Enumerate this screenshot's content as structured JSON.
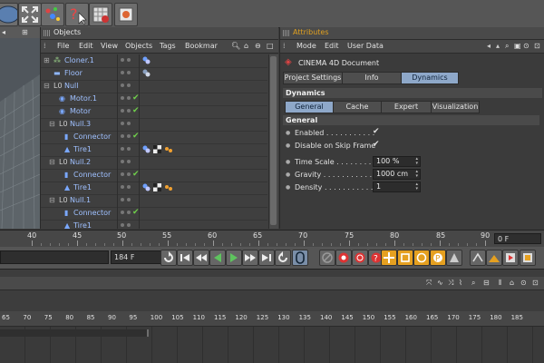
{
  "objects": {
    "title": "Objects",
    "menu": [
      "File",
      "Edit",
      "View",
      "Objects",
      "Tags",
      "Bookmarks"
    ],
    "rows": [
      {
        "label": "Cloner.1"
      },
      {
        "label": "Floor"
      },
      {
        "label": "Null"
      },
      {
        "label": "Motor.1"
      },
      {
        "label": "Motor"
      },
      {
        "label": "Null.3"
      },
      {
        "label": "Connector"
      },
      {
        "label": "Tire1"
      },
      {
        "label": "Null.2"
      },
      {
        "label": "Connector"
      },
      {
        "label": "Tire1"
      },
      {
        "label": "Null.1"
      },
      {
        "label": "Connector"
      },
      {
        "label": "Tire1"
      }
    ]
  },
  "attributes": {
    "title": "Attributes",
    "menu": [
      "Mode",
      "Edit",
      "User Data"
    ],
    "document": "CINEMA 4D Document",
    "tabs": [
      "Project Settings",
      "Info",
      "Dynamics"
    ],
    "active_tab": "Dynamics",
    "section_title": "Dynamics",
    "subtabs": [
      "General",
      "Cache",
      "Expert",
      "Visualization"
    ],
    "active_subtab": "General",
    "group_title": "General",
    "enabled_label": "Enabled . . . . . . . . . . .",
    "enabled_check": "✔",
    "disable_skip_label": "Disable on Skip Frame",
    "disable_skip_check": "✔",
    "time_scale_label": "Time Scale . . . . . . . . .",
    "time_scale_value": "100 %",
    "gravity_label": "Gravity . . . . . . . . . . .",
    "gravity_value": "1000 cm",
    "density_label": "Density . . . . . . . . . . .",
    "density_value": "1"
  },
  "timeline": {
    "ruler_labels": [
      "40",
      "45",
      "50",
      "55",
      "60",
      "65",
      "70",
      "75",
      "80",
      "85",
      "90"
    ],
    "current_frame_box": "0 F",
    "frame_field": "184 F",
    "lower_ruler_labels": [
      "65",
      "70",
      "75",
      "80",
      "85",
      "90",
      "95",
      "100",
      "105",
      "110",
      "115",
      "120",
      "125",
      "130",
      "135",
      "140",
      "145",
      "150",
      "155",
      "160",
      "165",
      "170",
      "175",
      "180",
      "185"
    ]
  },
  "colors": {
    "accent_blue": "#8ea8c9",
    "tree_text": "#9fc0ff",
    "check_green": "#6fcf4a",
    "attr_title": "#e0a020"
  }
}
